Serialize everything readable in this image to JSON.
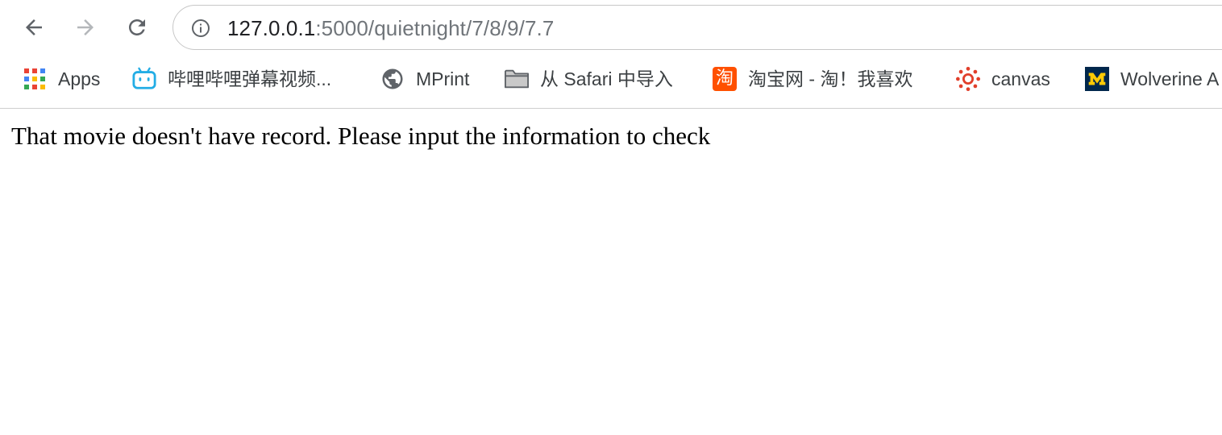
{
  "browser": {
    "url_host": "127.0.0.1",
    "url_path": ":5000/quietnight/7/8/9/7.7"
  },
  "bookmarks": [
    {
      "label": "Apps",
      "icon": "apps-grid-icon"
    },
    {
      "label": "哔哩哔哩弹幕视频...",
      "icon": "bilibili-tv-icon"
    },
    {
      "label": "MPrint",
      "icon": "globe-icon"
    },
    {
      "label": "从 Safari 中导入",
      "icon": "folder-icon"
    },
    {
      "label": "淘宝网 - 淘！我喜欢",
      "icon": "taobao-icon"
    },
    {
      "label": "canvas",
      "icon": "canvas-icon"
    },
    {
      "label": "Wolverine A",
      "icon": "michigan-m-icon"
    }
  ],
  "taobao_icon_char": "淘",
  "page": {
    "message": "That movie doesn't have record. Please input the information to check"
  },
  "colors": {
    "bilibili": "#23ade5",
    "taobao": "#ff5000",
    "canvas": "#e13f2b",
    "michigan_navy": "#00274c",
    "michigan_maize": "#ffcb05"
  }
}
